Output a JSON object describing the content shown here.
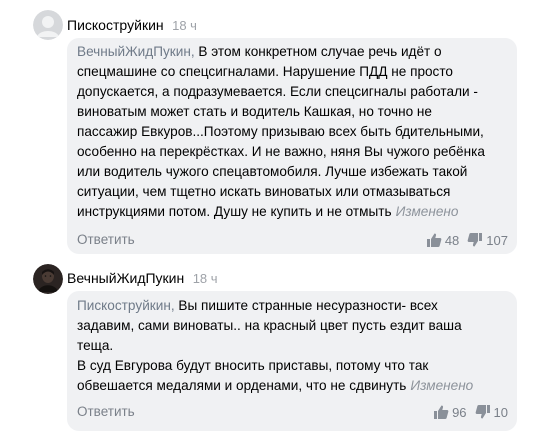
{
  "comments": [
    {
      "author": "Пискострyйкин",
      "time": "18 ч",
      "mention": "ВечныйЖидПукин,",
      "lines": [
        " В этом конкретном случае речь идёт о",
        "спецмашине со спецсигналами. Нарушение ПДД не просто",
        "допускается, а подразумевается. Если спецсигналы работали -",
        "виноватым может стать и водитель Кашкая, но точно не",
        "пассажир Евкуров...Поэтому призываю всех быть бдительными,",
        "особенно на перекрёстках. И не важно, няня Вы чужого ребёнка",
        "или водитель чужого спецавтомобиля. Лучше избежать такой",
        "ситуации, чем тщетно искать виноватых или отмазываться",
        "инструкциями потом. Душу не купить и не отмыть"
      ],
      "edited": "Изменено",
      "reply_label": "Ответить",
      "likes": "48",
      "dislikes": "107"
    },
    {
      "author": "ВечныйЖидПукин",
      "time": "18 ч",
      "mention": "Пискострyйкин,",
      "lines": [
        " Вы пишите странные несуразности- всех",
        "задавим, сами виноваты.. на красный цвет пусть ездит ваша",
        "теща.",
        "В суд Евгурова будут вносить приставы, потому что так",
        "обвешается медалями и орденами, что не сдвинуть"
      ],
      "edited": "Изменено",
      "reply_label": "Ответить",
      "likes": "96",
      "dislikes": "10"
    }
  ],
  "icons": {
    "like": "thumbs-up-icon",
    "dislike": "thumbs-down-icon",
    "default_avatar": "user-silhouette-icon",
    "photo_avatar": "user-photo-avatar"
  }
}
